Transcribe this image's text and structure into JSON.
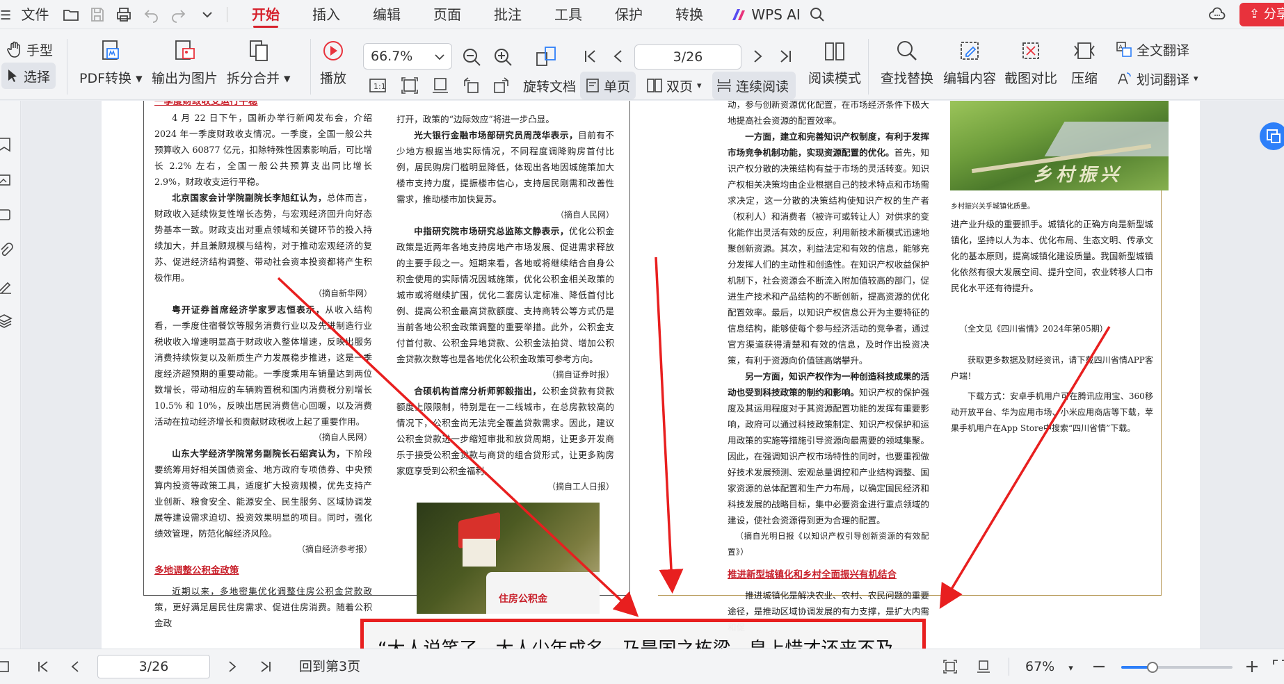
{
  "menubar": {
    "file_label": "文件",
    "tabs": [
      "开始",
      "插入",
      "编辑",
      "页面",
      "批注",
      "工具",
      "保护",
      "转换"
    ],
    "active_tab": "开始",
    "wps_ai_label": "WPS AI",
    "share_label": "分享"
  },
  "ribbon": {
    "hand_tool": "手型",
    "select_tool": "选择",
    "pdf_convert": "PDF转换",
    "export_image": "输出为图片",
    "split_merge": "拆分合并",
    "play": "播放",
    "zoom_value": "66.7%",
    "rotate_doc": "旋转文档",
    "page_value": "3/26",
    "single_page": "单页",
    "double_page": "双页",
    "continuous_read": "连续阅读",
    "reading_mode": "阅读模式",
    "find_replace": "查找替换",
    "edit_content": "编辑内容",
    "screenshot_compare": "截图对比",
    "compress": "压缩",
    "full_translate": "全文翻译",
    "word_translate": "划词翻译"
  },
  "document": {
    "col1": {
      "heading_partial": "一季度财政收支运行平稳",
      "p1": "4 月 22 日下午，国新办举行新闻发布会，介绍 2024 年一季度财政收支情况。一季度，全国一般公共预算收入 60877 亿元，扣除特殊性因素影响后，可比增长 2.2% 左右，全国一般公共预算支出同比增长 2.9%，财政收支运行平稳。",
      "p2_lead": "北京国家会计学院副院长李旭红认为，",
      "p2": "总体而言，财政收入延续恢复性增长态势，与宏观经济回升向好态势基本一致。财政支出对重点领域和关键环节的投入持续加大，并且兼顾规模与结构，对于推动宏观经济的复苏、促进经济结构调整、带动社会资本投资都将产生积极作用。",
      "src1": "（摘自新华网）",
      "p3_lead": "粤开证券首席经济学家罗志恒表示，",
      "p3": "从收入结构看，一季度住宿餐饮等服务消费行业以及先进制造行业税收收入增速明显高于财政收入整体增速，反映出服务消费持续恢复以及新质生产力发展稳步推进，这是一季度经济超预期的重要动能。一季度乘用车销量达到两位数增长，带动相应的车辆购置税和国内消费税分别增长 10.5% 和 10%，反映出居民消费信心回暖，以及消费活动在拉动经济增长和贡献财政税收上起了重要作用。",
      "src2": "（摘自人民网）",
      "p4_lead": "山东大学经济学院常务副院长石绍宾认为，",
      "p4": "下阶段要统筹用好相关国债资金、地方政府专项债券、中央预算内投资等政策工具，适度扩大投资规模，优先支持产业创新、粮食安全、能源安全、民生服务、区域协调发展等建设需求迫切、投资效果明显的项目。同时，强化绩效管理，防范化解经济风险。",
      "src3": "（摘自经济参考报）",
      "heading2": "多地调整公积金政策",
      "p5": "近期以来，多地密集优化调整住房公积金贷款政策，更好满足居民住房需求、促进住房消费。随着公积金政"
    },
    "col2": {
      "p1": "打开，政策的“边际效应”将进一步凸显。",
      "p2_lead": "光大银行金融市场部研究员周茂华表示，",
      "p2": "目前有不少地方根据当地实际情况，不同程度调降购房首付比例，居民购房门槛明显降低，体现出各地因城施策加大楼市支持力度，提振楼市信心，支持居民刚需和改善性需求，推动楼市加快复苏。",
      "src1": "（摘自人民网）",
      "p3_lead": "中指研究院市场研究总监陈文静表示，",
      "p3": "优化公积金政策是近两年各地支持房地产市场发展、促进需求释放的主要手段之一。短期来看，各地或将继续结合自身公积金使用的实际情况因城施策，优化公积金相关政策的城市或将继续扩围，优化二套房认定标准、降低首付比例、提高公积金最高贷款额度、支持商转公等方式仍是当前各地公积金政策调整的重要举措。此外，公积金支付首付款、公积金异地贷款、公积金法拍贷、增加公积金贷款次数等也是各地优化公积金政策可参考方向。",
      "src2": "（摘自证券时报）",
      "p4_lead": "合硕机构首席分析师郭毅指出，",
      "p4": "公积金贷款有贷款额度上限限制，特别是在一二线城市，在总房款较高的情况下，公积金尚无法完全覆盖贷款需求。因此，建议公积金贷款进一步缩短审批和放贷周期，让更多开发商乐于接受公积金贷款与商贷的组合贷形式，让更多购房家庭享受到公积金福利。",
      "src3": "（摘自工人日报）"
    },
    "col3": {
      "p1": "动，参与创新资源优化配置，在市场经济条件下极大地提高社会资源的配置效率。",
      "p2_lead": "一方面，建立和完善知识产权制度，有利于发挥市场竞争机制功能，实现资源配置的优化。",
      "p2": "首先，知识产权分散的决策结构有益于市场的灵活转变。知识产权相关决策均由企业根据自己的技术特点和市场需求决定，这一分散的决策结构使知识产权的生产者（权利人）和消费者（被许可或转让人）对供求的变化能作出灵活有效的反应，利用新技术新模式迅速地聚创新资源。其次，利益法定和有效的信息，能够充分发挥人们的主动性和创造性。在知识产权收益保护机制下，社会资源会不断流入附加值较高的部门，促进生产技术和产品结构的不断创新，提高资源的优化配置效率。最后，以知识产权信息公开为主要特征的信息结构，能够使每个参与经济活动的竞争者，通过官方渠道获得清楚和有效的信息，及时作出投资决策，有利于资源向价值链高端攀升。",
      "p3_lead": "另一方面，知识产权作为一种创造科技成果的活动也受到科技政策的制约和影响。",
      "p3": "知识产权的保护强度及其运用程度对于其资源配置功能的发挥有重要影响，政府可以通过科技政策制定、知识产权保护和运用政策的实施等措施引导资源向最需要的领域集聚。因此，在强调知识产权市场特性的同时，也要重视做好技术发展预测、宏观总量调控和产业结构调整、国家资源的总体配置和生产力布局，以确定国民经济和科技发展的战略目标，集中必要资金进行重点领域的建设，使社会资源得到更为合理的配置。",
      "src1": "（摘自光明日报《以知识产权引导创新资源的有效配置》）",
      "heading": "推进新型城镇化和乡村全面振兴有机结合",
      "p4": "推进城镇化是解决农业、农村、农民问题的重要途径，是推动区域协调发展的有力支撑，是扩大内需和促"
    },
    "col4": {
      "image_caption": "乡村振兴关乎城镇化质量。",
      "image_text": "乡村振兴",
      "p1": "进产业升级的重要抓手。城镇化的正确方向是新型城镇化，坚持以人为本、优化布局、生态文明、传承文化的基本原则，提高城镇化建设质量。我国新型城镇化依然有很大发展空间、提升空间，农业转移人口市民化水平还有待提升。",
      "source_note": "（全文见《四川省情》2024年第05期）",
      "p2": "获取更多数据及财经资讯，请下载四川省情APP客户端！",
      "p3": "下载方式：安卓手机用户可在腾讯应用宝、360移动开放平台、华为应用市场、小米应用商店等下载，苹果手机用户在App Store中搜索“四川省情”下载。"
    },
    "house_image_text": "住房公积金"
  },
  "caption": {
    "text": "“大人说笑了，大人少年成名，乃是国之栋梁，皇上惜才还来不及"
  },
  "statusbar": {
    "page_value": "3/26",
    "back_to_page": "回到第3页",
    "zoom_value": "67%",
    "zoom_fraction": 0.28
  },
  "colors": {
    "accent_red": "#d6212c",
    "arrow_red": "#e81f1f",
    "link_blue": "#2d7ff9"
  }
}
